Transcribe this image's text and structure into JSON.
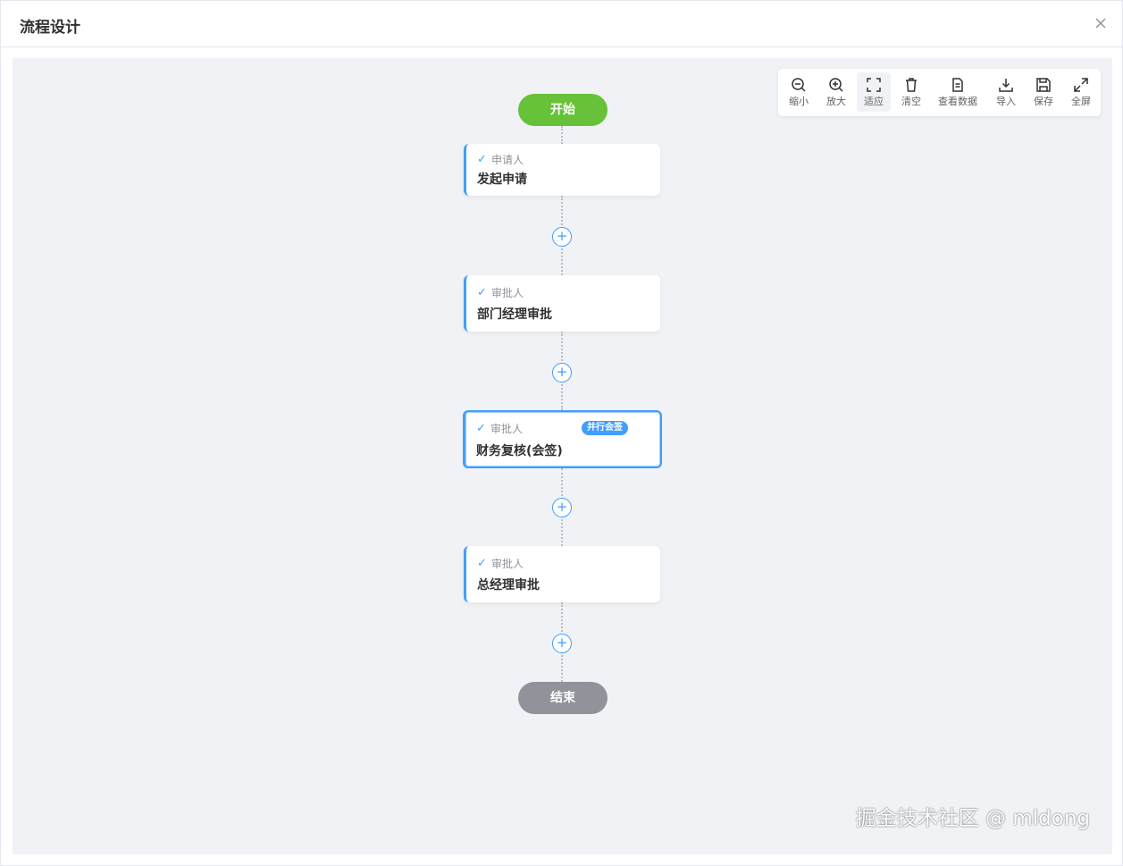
{
  "dialog": {
    "title": "流程设计"
  },
  "toolbar": {
    "zoom_out": "缩小",
    "zoom_in": "放大",
    "fit": "适应",
    "clear": "清空",
    "view_data": "查看数据",
    "import": "导入",
    "save": "保存",
    "fullscreen": "全屏"
  },
  "flow": {
    "start_label": "开始",
    "end_label": "结束",
    "add_symbol": "+",
    "check_symbol": "✓",
    "nodes": [
      {
        "type": "申请人",
        "name": "发起申请"
      },
      {
        "type": "审批人",
        "name": "部门经理审批"
      },
      {
        "type": "审批人",
        "name": "财务复核(会签)",
        "badge": "并行会签"
      },
      {
        "type": "审批人",
        "name": "总经理审批"
      }
    ]
  },
  "watermark": "掘金技术社区 @ mldong"
}
